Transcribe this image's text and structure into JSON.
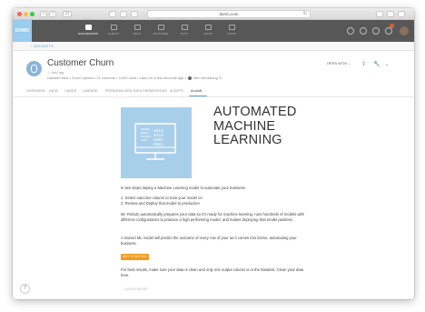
{
  "browser": {
    "url": "domo.com",
    "buttons": [
      "‹",
      "›",
      "▭"
    ]
  },
  "nav": {
    "logo": "DOMO",
    "items": [
      {
        "label": "DASHBOARDS",
        "active": true
      },
      {
        "label": "ALERTS",
        "active": false
      },
      {
        "label": "BUZZ",
        "active": false
      },
      {
        "label": "APPSTORE",
        "active": false
      },
      {
        "label": "DATA",
        "active": false
      },
      {
        "label": "ADMIN",
        "active": false
      },
      {
        "label": "MORE",
        "active": false
      }
    ]
  },
  "breadcrumb": "‹ DATASETS",
  "dataset": {
    "title": "Customer Churn",
    "star": "☆ Add tag",
    "meta_parts": [
      "Dataset View",
      "• Excel Upload",
      "• 21 columns",
      "• 3,000 rows",
      "• Last run a few seconds ago",
      "•"
    ],
    "owner": "Ben Armstrong",
    "open_with": "OPEN WITH ⌄"
  },
  "tabs": [
    {
      "label": "OVERVIEW",
      "active": false
    },
    {
      "label": "DATA",
      "active": false
    },
    {
      "label": "CARDS",
      "active": false
    },
    {
      "label": "LINEAGE",
      "active": false
    },
    {
      "label": "PERSONALIZED DATA PERMISSIONS",
      "active": false
    },
    {
      "label": "ALERTS",
      "active": false
    },
    {
      "label": "AutoML",
      "active": true
    }
  ],
  "content": {
    "hero_title_lines": [
      "AUTOMATED",
      "MACHINE",
      "LEARNING"
    ],
    "intro": "In two steps deploy a Machine Learning model to automate your business:",
    "step1": "1. Select outcome column to train your model on",
    "step2": "2. Review and Deploy that model to production",
    "para1": "Mr. Roboto automatically prepares your data so it's ready for machine learning, runs hundreds of models with different configurations to produce a high performing model, and makes deploying that model painless.",
    "para2": "A trained ML model will predict the outcome of every row of your as it comes into Domo, automating your business.",
    "get_started": "GET STARTED",
    "para3": "For best results, make sure your data is clean and only one output column is in the DataSet. Clean your data here.",
    "learn_more": "LEARN MORE",
    "help": "?"
  },
  "colors": {
    "nav_bg": "#575757",
    "logo_bg": "#99ccee",
    "hero_bg": "#a8cfea",
    "accent": "#f39a1e",
    "tab_active": "#52a7da"
  }
}
